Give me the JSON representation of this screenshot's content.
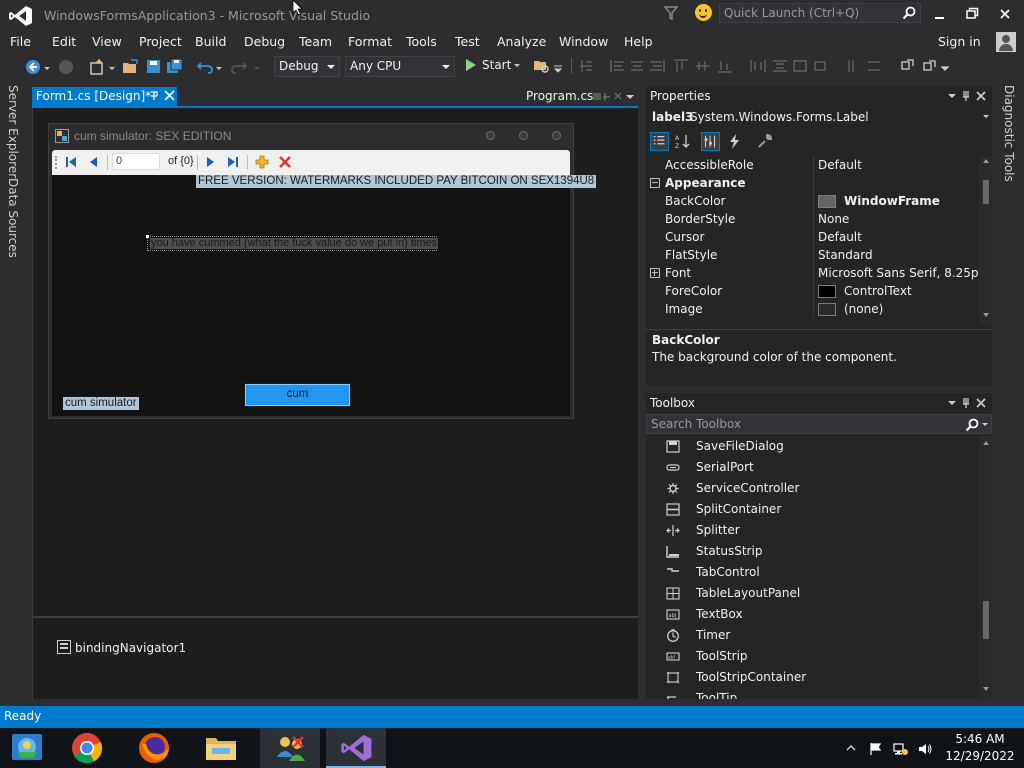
{
  "window": {
    "title": "WindowsFormsApplication3 - Microsoft Visual Studio",
    "quick_launch_placeholder": "Quick Launch (Ctrl+Q)"
  },
  "menu": {
    "items": [
      "File",
      "Edit",
      "View",
      "Project",
      "Build",
      "Debug",
      "Team",
      "Format",
      "Tools",
      "Test",
      "Analyze",
      "Window",
      "Help"
    ],
    "sign_in": "Sign in"
  },
  "toolbar": {
    "configuration": "Debug",
    "platform": "Any CPU",
    "start_label": "Start"
  },
  "side_tabs": {
    "left": [
      "Server Explorer",
      "Data Sources"
    ],
    "right": [
      "Diagnostic Tools"
    ]
  },
  "documents": {
    "active_tab": "Form1.cs [Design]*",
    "other_tab": "Program.cs"
  },
  "form": {
    "title": "cum simulator: SEX EDITION",
    "binding_navigator": {
      "position": "0",
      "count": "of {0}"
    },
    "label_watermark": "FREE VERSION: WATERMARKS INCLUDED PAY BITCOIN ON SEX1394U8",
    "label_counter": "you have cummed (what the fuck value do we put in) times",
    "label_simulator": "cum simulator",
    "button_label": "cum"
  },
  "component_tray": {
    "items": [
      "bindingNavigator1"
    ]
  },
  "properties": {
    "title": "Properties",
    "object_name": "label3",
    "object_type": "System.Windows.Forms.Label",
    "rows": [
      {
        "name": "AccessibleRole",
        "value": "Default"
      },
      {
        "category": "Appearance"
      },
      {
        "name": "BackColor",
        "value": "WindowFrame",
        "swatch": "#646464",
        "bold": true
      },
      {
        "name": "BorderStyle",
        "value": "None"
      },
      {
        "name": "Cursor",
        "value": "Default"
      },
      {
        "name": "FlatStyle",
        "value": "Standard"
      },
      {
        "name": "Font",
        "value": "Microsoft Sans Serif, 8.25pt",
        "expandable": true
      },
      {
        "name": "ForeColor",
        "value": "ControlText",
        "swatch": "#000000"
      },
      {
        "name": "Image",
        "value": "(none)",
        "swatch": "#2a2a2a"
      }
    ],
    "description_title": "BackColor",
    "description_text": "The background color of the component."
  },
  "toolbox": {
    "title": "Toolbox",
    "search_placeholder": "Search Toolbox",
    "items": [
      {
        "label": "SaveFileDialog",
        "icon": "savefiledialog-icon"
      },
      {
        "label": "SerialPort",
        "icon": "serialport-icon"
      },
      {
        "label": "ServiceController",
        "icon": "servicecontroller-icon"
      },
      {
        "label": "SplitContainer",
        "icon": "splitcontainer-icon"
      },
      {
        "label": "Splitter",
        "icon": "splitter-icon"
      },
      {
        "label": "StatusStrip",
        "icon": "statusstrip-icon"
      },
      {
        "label": "TabControl",
        "icon": "tabcontrol-icon"
      },
      {
        "label": "TableLayoutPanel",
        "icon": "tablelayoutpanel-icon"
      },
      {
        "label": "TextBox",
        "icon": "textbox-icon"
      },
      {
        "label": "Timer",
        "icon": "timer-icon"
      },
      {
        "label": "ToolStrip",
        "icon": "toolstrip-icon"
      },
      {
        "label": "ToolStripContainer",
        "icon": "toolstripcontainer-icon"
      },
      {
        "label": "ToolTip",
        "icon": "tooltip-icon"
      }
    ]
  },
  "status": {
    "text": "Ready"
  },
  "taskbar": {
    "apps": [
      "control-panel-icon",
      "chrome-icon",
      "firefox-icon",
      "file-explorer-icon",
      "network-people-icon",
      "visual-studio-icon"
    ],
    "time": "5:46 AM",
    "date": "12/29/2022"
  },
  "colors": {
    "accent": "#007acc",
    "chrome_bg": "#2d2d30",
    "editor_bg": "#1e1e1e",
    "button_blue": "#2196f3"
  }
}
